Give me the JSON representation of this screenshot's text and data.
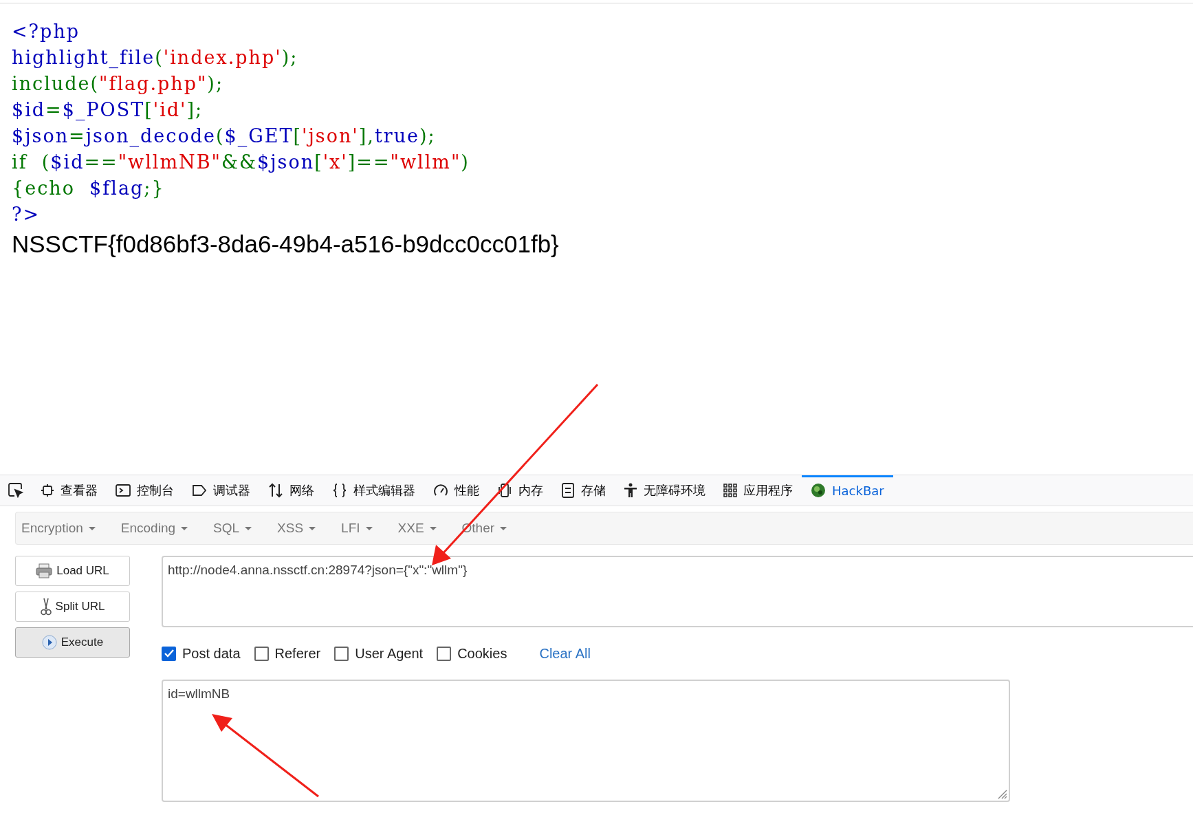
{
  "source_code": {
    "lines": [
      [
        {
          "kind": "default",
          "text": "<?php"
        }
      ],
      [
        {
          "kind": "default",
          "text": "highlight_file"
        },
        {
          "kind": "keyword",
          "text": "("
        },
        {
          "kind": "string",
          "text": "'index.php'"
        },
        {
          "kind": "keyword",
          "text": ");"
        }
      ],
      [
        {
          "kind": "keyword",
          "text": "include("
        },
        {
          "kind": "string",
          "text": "\"flag.php\""
        },
        {
          "kind": "keyword",
          "text": ");"
        }
      ],
      [
        {
          "kind": "default",
          "text": "$id"
        },
        {
          "kind": "keyword",
          "text": "="
        },
        {
          "kind": "default",
          "text": "$_POST"
        },
        {
          "kind": "keyword",
          "text": "["
        },
        {
          "kind": "string",
          "text": "'id'"
        },
        {
          "kind": "keyword",
          "text": "];"
        }
      ],
      [
        {
          "kind": "default",
          "text": "$json"
        },
        {
          "kind": "keyword",
          "text": "="
        },
        {
          "kind": "default",
          "text": "json_decode"
        },
        {
          "kind": "keyword",
          "text": "("
        },
        {
          "kind": "default",
          "text": "$_GET"
        },
        {
          "kind": "keyword",
          "text": "["
        },
        {
          "kind": "string",
          "text": "'json'"
        },
        {
          "kind": "keyword",
          "text": "],"
        },
        {
          "kind": "default",
          "text": "true"
        },
        {
          "kind": "keyword",
          "text": ");"
        }
      ],
      [
        {
          "kind": "keyword",
          "text": "if  ("
        },
        {
          "kind": "default",
          "text": "$id"
        },
        {
          "kind": "keyword",
          "text": "=="
        },
        {
          "kind": "string",
          "text": "\"wllmNB\""
        },
        {
          "kind": "keyword",
          "text": "&&"
        },
        {
          "kind": "default",
          "text": "$json"
        },
        {
          "kind": "keyword",
          "text": "["
        },
        {
          "kind": "string",
          "text": "'x'"
        },
        {
          "kind": "keyword",
          "text": "]=="
        },
        {
          "kind": "string",
          "text": "\"wllm\""
        },
        {
          "kind": "keyword",
          "text": ")"
        }
      ],
      [
        {
          "kind": "keyword",
          "text": "{echo  "
        },
        {
          "kind": "default",
          "text": "$flag"
        },
        {
          "kind": "keyword",
          "text": ";}"
        }
      ],
      [
        {
          "kind": "default",
          "text": "?>"
        }
      ]
    ]
  },
  "output": "NSSCTF{f0d86bf3-8da6-49b4-a516-b9dcc0cc01fb}",
  "devtools": {
    "tabs": [
      {
        "kind": "inspector",
        "label": "查看器",
        "selected": false
      },
      {
        "kind": "console",
        "label": "控制台",
        "selected": false
      },
      {
        "kind": "debugger",
        "label": "调试器",
        "selected": false
      },
      {
        "kind": "network",
        "label": "网络",
        "selected": false
      },
      {
        "kind": "style",
        "label": "样式编辑器",
        "selected": false
      },
      {
        "kind": "performance",
        "label": "性能",
        "selected": false
      },
      {
        "kind": "memory",
        "label": "内存",
        "selected": false
      },
      {
        "kind": "storage",
        "label": "存储",
        "selected": false
      },
      {
        "kind": "accessibility",
        "label": "无障碍环境",
        "selected": false
      },
      {
        "kind": "application",
        "label": "应用程序",
        "selected": false
      },
      {
        "kind": "hackbar",
        "label": "HackBar",
        "selected": true
      }
    ]
  },
  "hackbar": {
    "menus": [
      "Encryption",
      "Encoding",
      "SQL",
      "XSS",
      "LFI",
      "XXE",
      "Other"
    ],
    "buttons": [
      {
        "kind": "load",
        "label": "Load URL",
        "active": false
      },
      {
        "kind": "split",
        "label": "Split URL",
        "active": false
      },
      {
        "kind": "execute",
        "label": "Execute",
        "active": true
      }
    ],
    "url": "http://node4.anna.nssctf.cn:28974?json={\"x\":\"wllm\"}",
    "options": [
      {
        "label": "Post data",
        "checked": true
      },
      {
        "label": "Referer",
        "checked": false
      },
      {
        "label": "User Agent",
        "checked": false
      },
      {
        "label": "Cookies",
        "checked": false
      }
    ],
    "clear_all": "Clear All",
    "post_body": "id=wllmNB"
  }
}
